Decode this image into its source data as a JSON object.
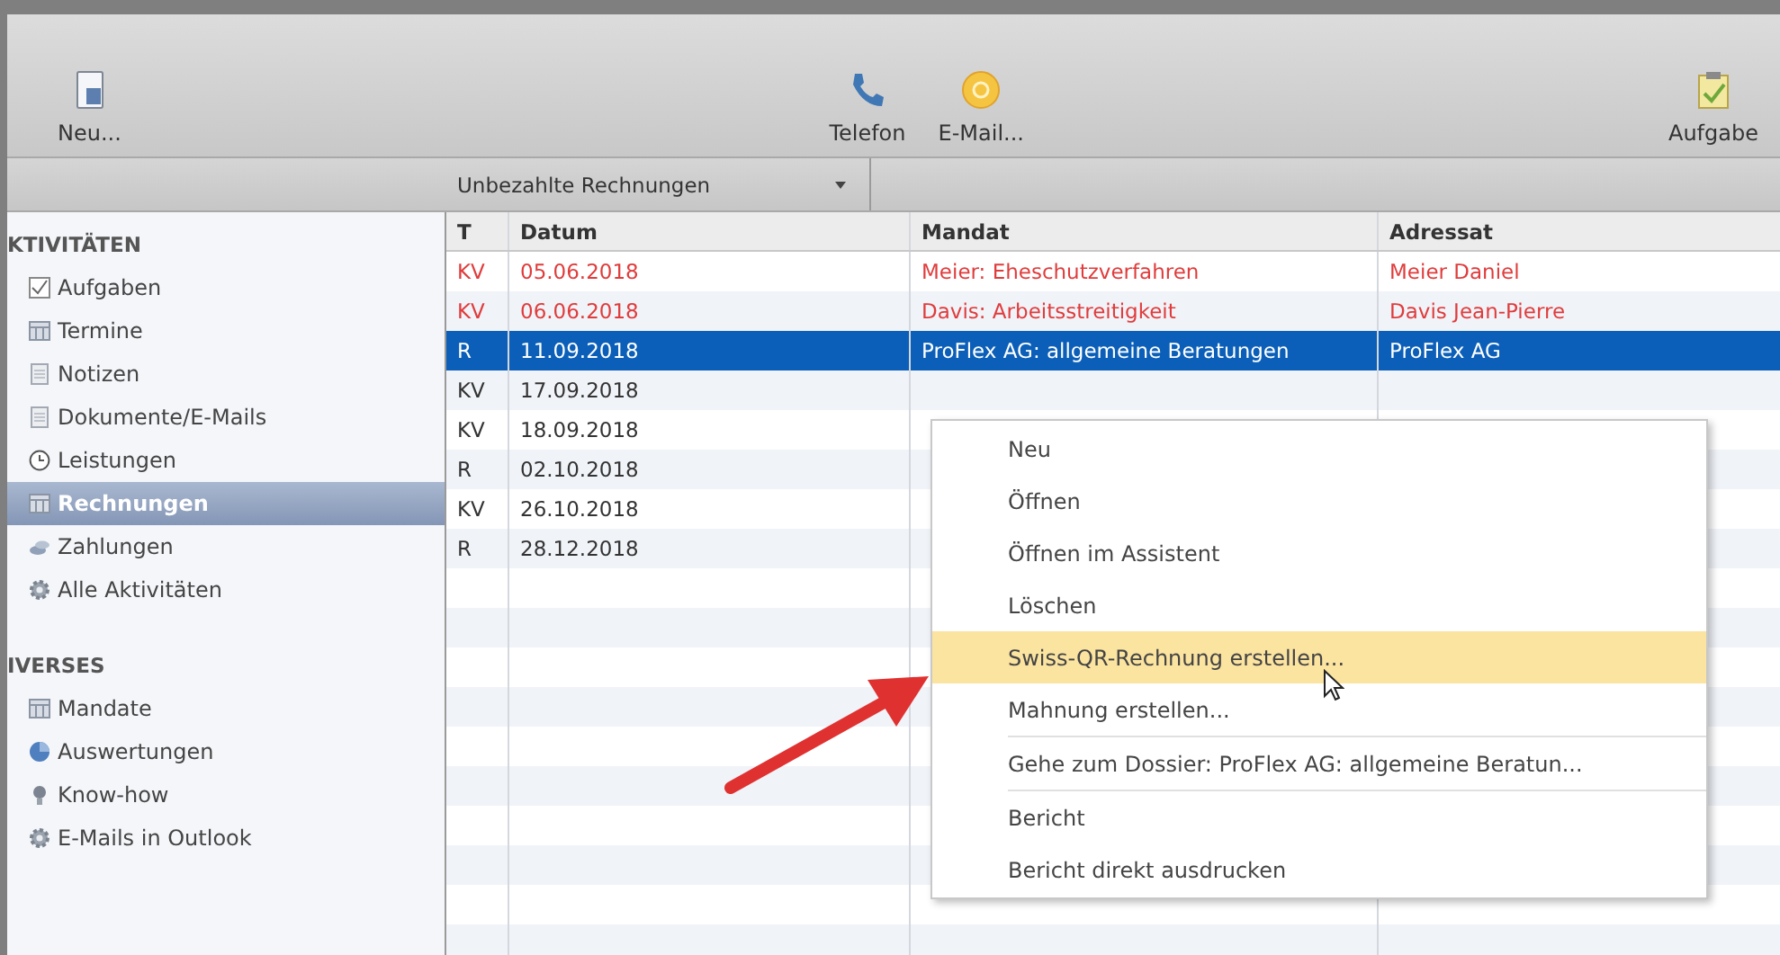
{
  "toolbar": {
    "buttons": [
      {
        "label": "Neu...",
        "kind": "document"
      },
      {
        "label": "Telefon",
        "kind": "phone"
      },
      {
        "label": "E-Mail...",
        "kind": "mail"
      },
      {
        "label": "Aufgabe",
        "kind": "task"
      }
    ]
  },
  "filter": {
    "value": "Unbezahlte Rechnungen"
  },
  "sidebar": {
    "sections": [
      {
        "title": "KTIVITÄTEN",
        "items": [
          {
            "label": "Aufgaben",
            "kind": "check",
            "selected": false
          },
          {
            "label": "Termine",
            "kind": "calendar",
            "selected": false
          },
          {
            "label": "Notizen",
            "kind": "note",
            "selected": false
          },
          {
            "label": "Dokumente/E-Mails",
            "kind": "note",
            "selected": false
          },
          {
            "label": "Leistungen",
            "kind": "clock",
            "selected": false
          },
          {
            "label": "Rechnungen",
            "kind": "calendar",
            "selected": true
          },
          {
            "label": "Zahlungen",
            "kind": "coins",
            "selected": false
          },
          {
            "label": "Alle Aktivitäten",
            "kind": "gear",
            "selected": false
          }
        ]
      },
      {
        "title": "IVERSES",
        "items": [
          {
            "label": "Mandate",
            "kind": "calendar",
            "selected": false
          },
          {
            "label": "Auswertungen",
            "kind": "chart",
            "selected": false
          },
          {
            "label": "Know-how",
            "kind": "bulb",
            "selected": false
          },
          {
            "label": "E-Mails in Outlook",
            "kind": "gear",
            "selected": false
          }
        ]
      }
    ]
  },
  "table": {
    "columns": [
      "T",
      "Datum",
      "Mandat",
      "Adressat"
    ],
    "rows": [
      {
        "t": "KV",
        "datum": "05.06.2018",
        "mandat": "Meier: Eheschutzverfahren",
        "adressat": "Meier Daniel",
        "overdue": true,
        "selected": false
      },
      {
        "t": "KV",
        "datum": "06.06.2018",
        "mandat": "Davis: Arbeitsstreitigkeit",
        "adressat": "Davis Jean-Pierre",
        "overdue": true,
        "selected": false
      },
      {
        "t": "R",
        "datum": "11.09.2018",
        "mandat": "ProFlex AG: allgemeine Beratungen",
        "adressat": "ProFlex AG",
        "overdue": false,
        "selected": true
      },
      {
        "t": "KV",
        "datum": "17.09.2018",
        "overdue": false,
        "selected": false
      },
      {
        "t": "KV",
        "datum": "18.09.2018",
        "overdue": false,
        "selected": false
      },
      {
        "t": "R",
        "datum": "02.10.2018",
        "overdue": false,
        "selected": false
      },
      {
        "t": "KV",
        "datum": "26.10.2018",
        "overdue": false,
        "selected": false
      },
      {
        "t": "R",
        "datum": "28.12.2018",
        "overdue": false,
        "selected": false
      }
    ]
  },
  "context_menu": {
    "items": [
      {
        "label": "Neu",
        "selected": false,
        "separator_after": false
      },
      {
        "label": "Öffnen",
        "selected": false,
        "separator_after": false
      },
      {
        "label": "Öffnen im Assistent",
        "selected": false,
        "separator_after": false
      },
      {
        "label": "Löschen",
        "selected": false,
        "separator_after": false
      },
      {
        "label": "Swiss-QR-Rechnung erstellen...",
        "selected": true,
        "separator_after": false
      },
      {
        "label": "Mahnung erstellen...",
        "selected": false,
        "separator_after": true
      },
      {
        "label": "Gehe zum Dossier: ProFlex AG: allgemeine Beratun...",
        "selected": false,
        "separator_after": true
      },
      {
        "label": "Bericht",
        "selected": false,
        "separator_after": false
      },
      {
        "label": "Bericht direkt ausdrucken",
        "selected": false,
        "separator_after": false
      }
    ]
  }
}
